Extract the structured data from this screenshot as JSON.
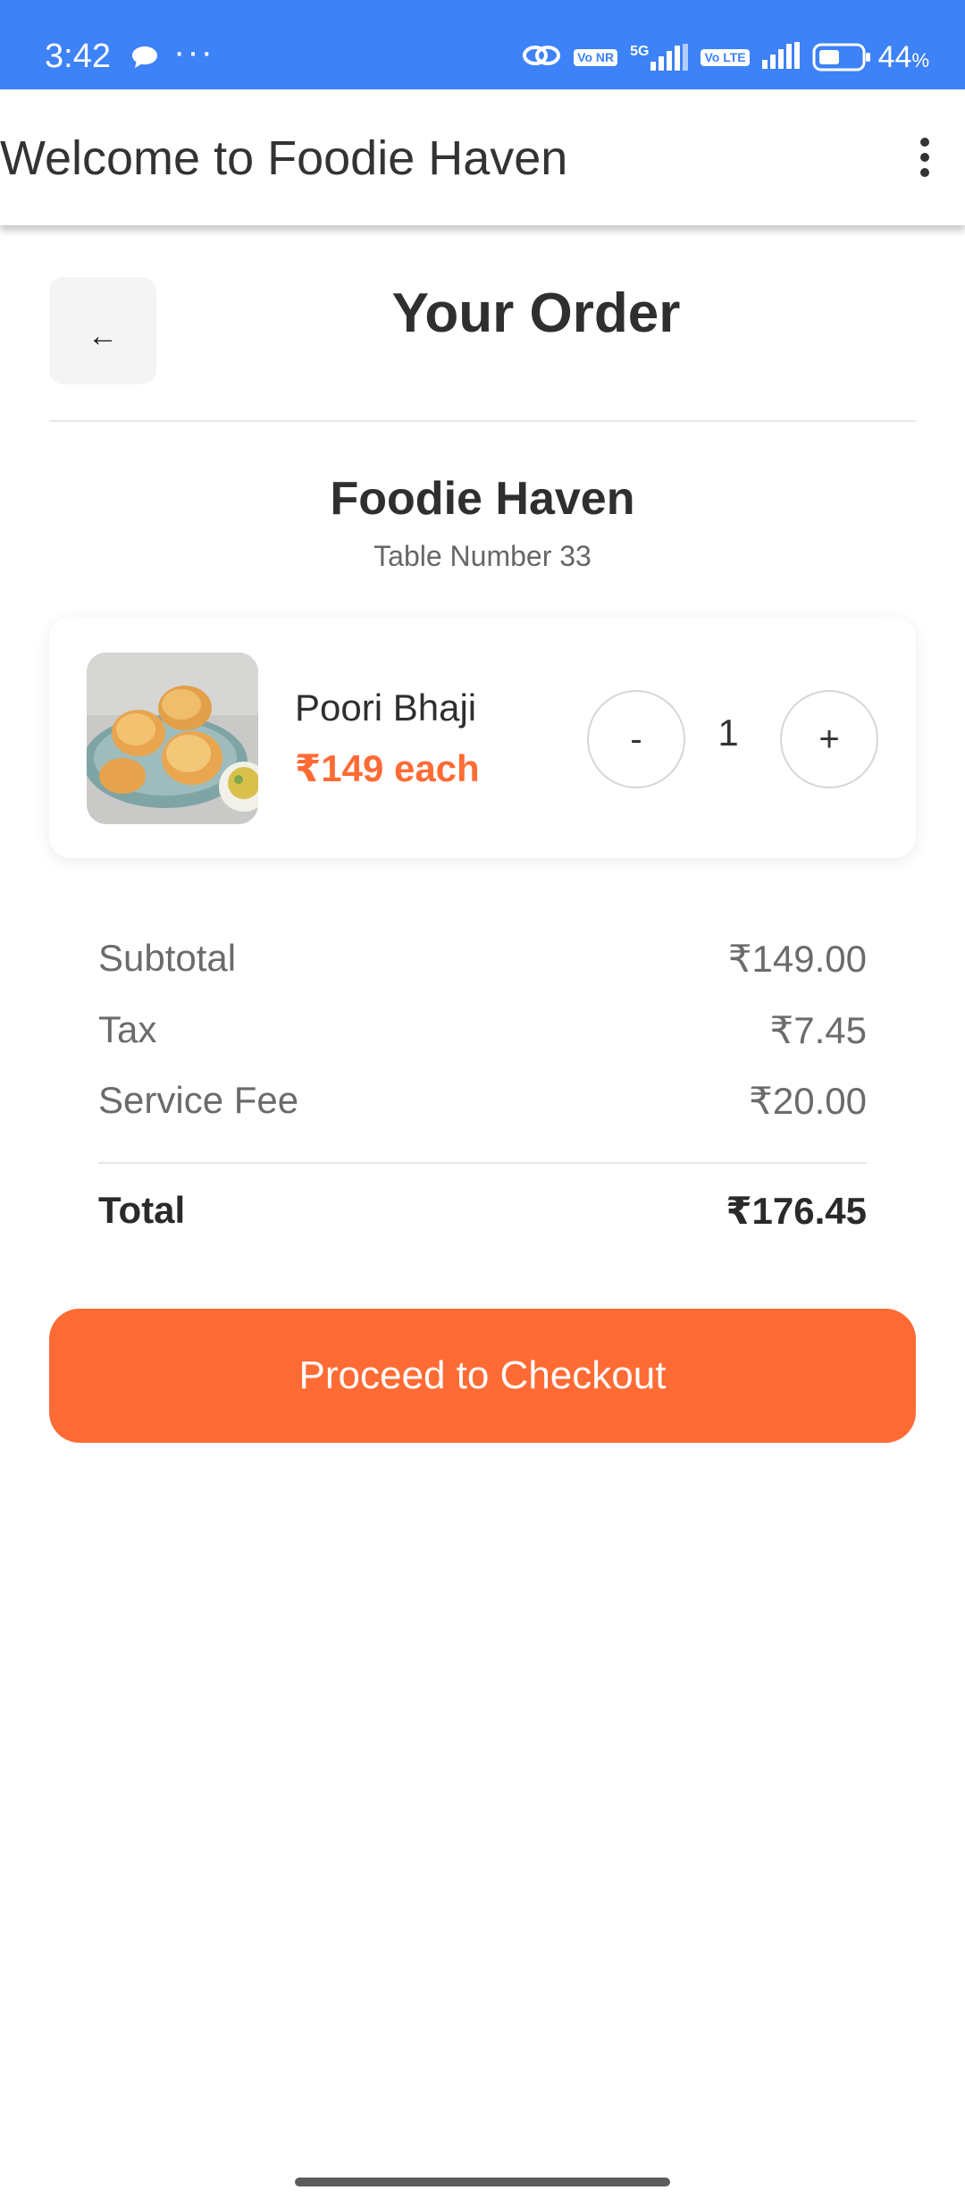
{
  "status_bar": {
    "time": "3:42",
    "network_tag_1": "Vo NR",
    "network_type": "5G",
    "network_tag_2": "Vo LTE",
    "battery_percent": "44",
    "battery_unit": "%"
  },
  "app_bar": {
    "title": "Welcome to Foodie Haven",
    "menu_icon": "more-vert-icon"
  },
  "header": {
    "back_label": "←",
    "title": "Your Order"
  },
  "restaurant": {
    "name": "Foodie Haven",
    "table": "Table Number 33"
  },
  "items": [
    {
      "name": "Poori Bhaji",
      "price": "₹149 each",
      "quantity": "1",
      "decrement_label": "-",
      "increment_label": "+"
    }
  ],
  "summary": {
    "subtotal_label": "Subtotal",
    "subtotal_value": "₹149.00",
    "tax_label": "Tax",
    "tax_value": "₹7.45",
    "fee_label": "Service Fee",
    "fee_value": "₹20.00",
    "total_label": "Total",
    "total_value": "₹176.45"
  },
  "checkout": {
    "label": "Proceed to Checkout"
  },
  "colors": {
    "status_bar": "#3d82f6",
    "accent": "#ff6b35"
  }
}
